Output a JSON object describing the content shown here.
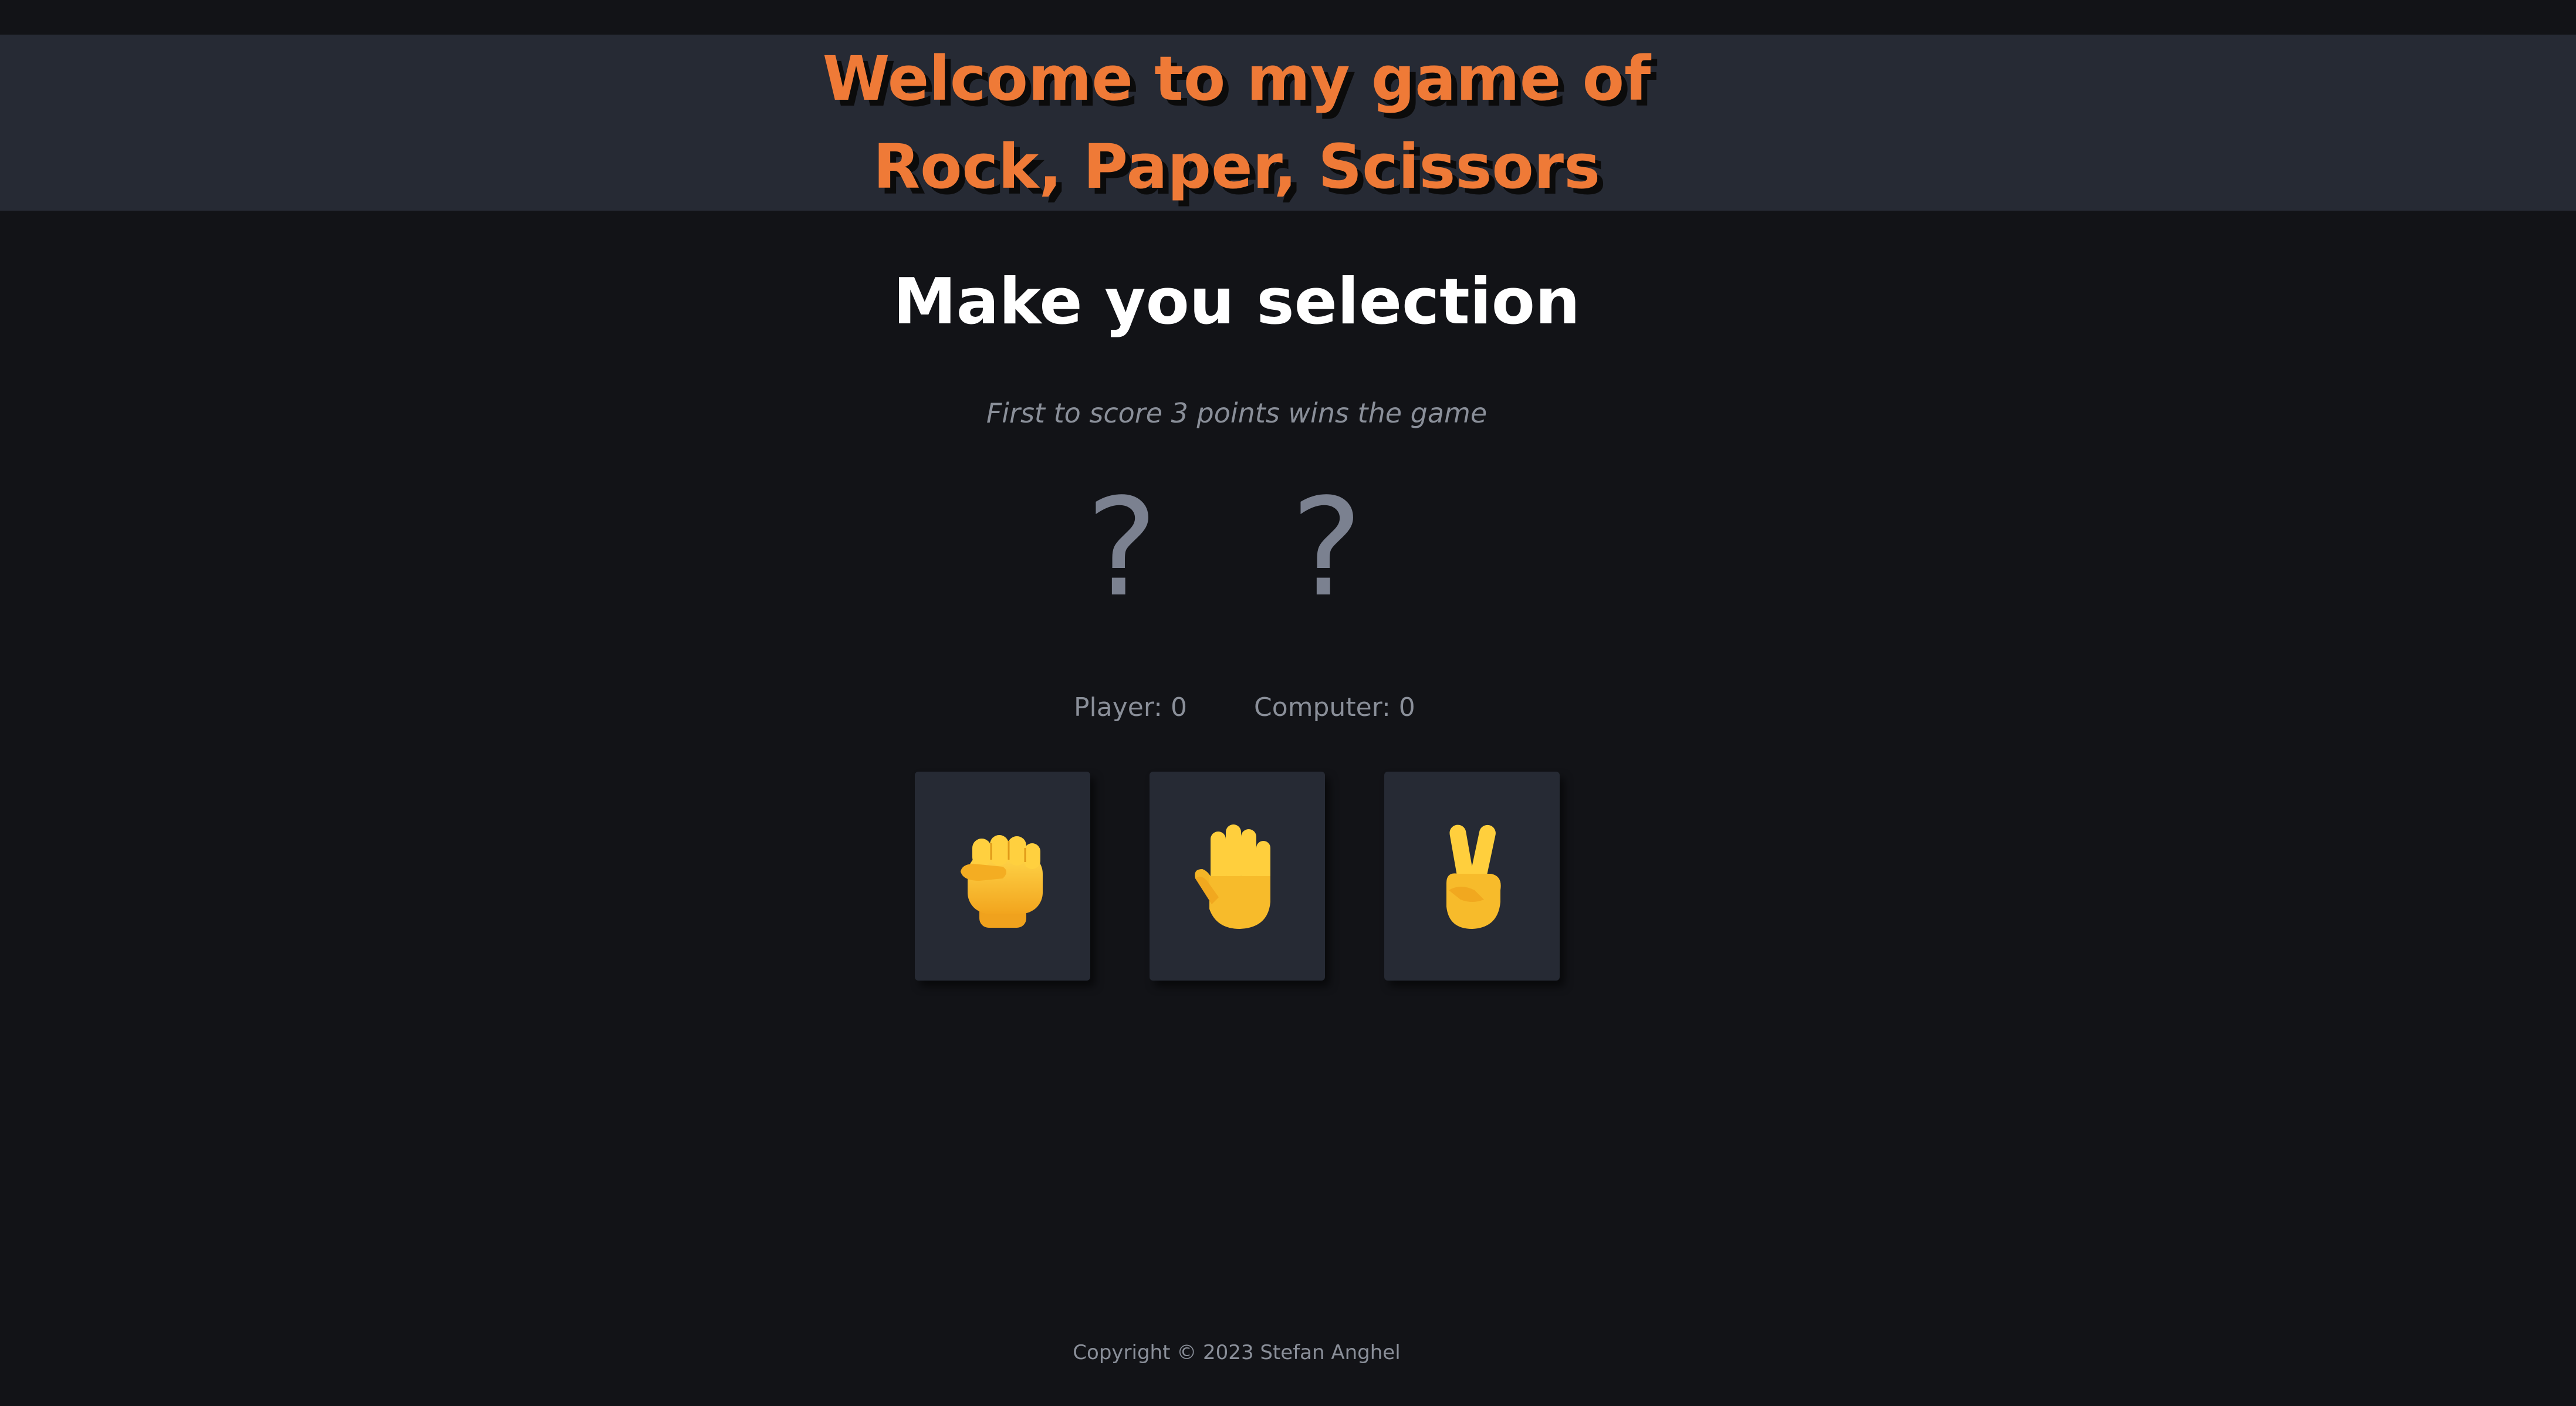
{
  "header": {
    "title_line1": "Welcome to my game of",
    "title_line2": "Rock, Paper, Scissors"
  },
  "main": {
    "heading": "Make you selection",
    "hint": "First to score 3 points wins the game",
    "player_choice": "?",
    "computer_choice": "?",
    "player_score": "Player: 0",
    "computer_score": "Computer: 0",
    "buttons": [
      {
        "name": "rock",
        "icon": "raised-fist-icon"
      },
      {
        "name": "paper",
        "icon": "raised-hand-icon"
      },
      {
        "name": "scissors",
        "icon": "victory-hand-icon"
      }
    ]
  },
  "footer": {
    "copyright": "Copyright © 2023 Stefan Anghel"
  },
  "colors": {
    "background": "#121317",
    "header_bg": "#262a34",
    "title_accent": "#ef7a37",
    "heading_text": "#ffffff",
    "muted_text": "#8a8f99",
    "question_mark": "#7b8190",
    "emoji_skin": "#f7b92b"
  }
}
